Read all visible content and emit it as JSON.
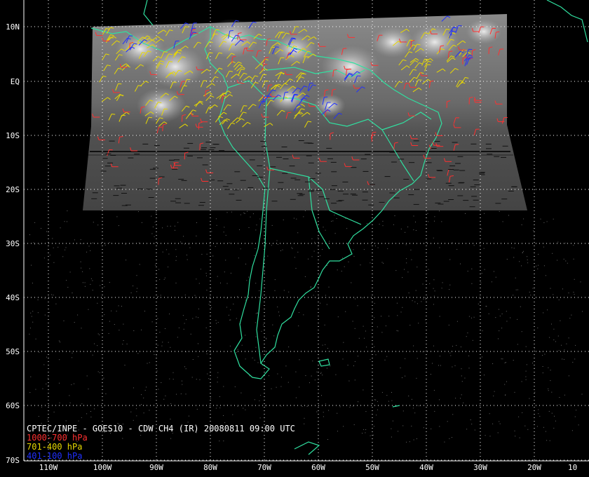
{
  "title": "CPTEC/INPE - GOES10 - CDW CH4 (IR) 20080811 09:00 UTC",
  "legend": [
    {
      "label": "1000-700 hPa",
      "color": "#ff3030"
    },
    {
      "label": "701-400 hPa",
      "color": "#e8d800"
    },
    {
      "label": "401-100 hPa",
      "color": "#2030ff"
    }
  ],
  "lat_labels": [
    "10N",
    "EQ",
    "10S",
    "20S",
    "30S",
    "40S",
    "50S",
    "60S",
    "70S"
  ],
  "lon_labels": [
    "110W",
    "100W",
    "90W",
    "80W",
    "70W",
    "60W",
    "50W",
    "40W",
    "30W",
    "20W",
    "10"
  ],
  "colors": {
    "coastline": "#30e0a0",
    "grid": "#ffffff",
    "background": "#000000"
  }
}
